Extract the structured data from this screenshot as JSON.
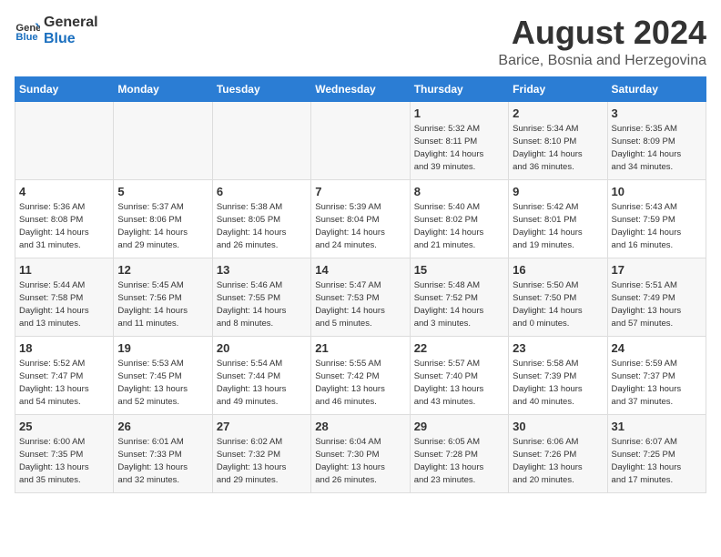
{
  "header": {
    "logo_line1": "General",
    "logo_line2": "Blue",
    "month_year": "August 2024",
    "location": "Barice, Bosnia and Herzegovina"
  },
  "days_of_week": [
    "Sunday",
    "Monday",
    "Tuesday",
    "Wednesday",
    "Thursday",
    "Friday",
    "Saturday"
  ],
  "weeks": [
    [
      {
        "day": "",
        "info": ""
      },
      {
        "day": "",
        "info": ""
      },
      {
        "day": "",
        "info": ""
      },
      {
        "day": "",
        "info": ""
      },
      {
        "day": "1",
        "info": "Sunrise: 5:32 AM\nSunset: 8:11 PM\nDaylight: 14 hours\nand 39 minutes."
      },
      {
        "day": "2",
        "info": "Sunrise: 5:34 AM\nSunset: 8:10 PM\nDaylight: 14 hours\nand 36 minutes."
      },
      {
        "day": "3",
        "info": "Sunrise: 5:35 AM\nSunset: 8:09 PM\nDaylight: 14 hours\nand 34 minutes."
      }
    ],
    [
      {
        "day": "4",
        "info": "Sunrise: 5:36 AM\nSunset: 8:08 PM\nDaylight: 14 hours\nand 31 minutes."
      },
      {
        "day": "5",
        "info": "Sunrise: 5:37 AM\nSunset: 8:06 PM\nDaylight: 14 hours\nand 29 minutes."
      },
      {
        "day": "6",
        "info": "Sunrise: 5:38 AM\nSunset: 8:05 PM\nDaylight: 14 hours\nand 26 minutes."
      },
      {
        "day": "7",
        "info": "Sunrise: 5:39 AM\nSunset: 8:04 PM\nDaylight: 14 hours\nand 24 minutes."
      },
      {
        "day": "8",
        "info": "Sunrise: 5:40 AM\nSunset: 8:02 PM\nDaylight: 14 hours\nand 21 minutes."
      },
      {
        "day": "9",
        "info": "Sunrise: 5:42 AM\nSunset: 8:01 PM\nDaylight: 14 hours\nand 19 minutes."
      },
      {
        "day": "10",
        "info": "Sunrise: 5:43 AM\nSunset: 7:59 PM\nDaylight: 14 hours\nand 16 minutes."
      }
    ],
    [
      {
        "day": "11",
        "info": "Sunrise: 5:44 AM\nSunset: 7:58 PM\nDaylight: 14 hours\nand 13 minutes."
      },
      {
        "day": "12",
        "info": "Sunrise: 5:45 AM\nSunset: 7:56 PM\nDaylight: 14 hours\nand 11 minutes."
      },
      {
        "day": "13",
        "info": "Sunrise: 5:46 AM\nSunset: 7:55 PM\nDaylight: 14 hours\nand 8 minutes."
      },
      {
        "day": "14",
        "info": "Sunrise: 5:47 AM\nSunset: 7:53 PM\nDaylight: 14 hours\nand 5 minutes."
      },
      {
        "day": "15",
        "info": "Sunrise: 5:48 AM\nSunset: 7:52 PM\nDaylight: 14 hours\nand 3 minutes."
      },
      {
        "day": "16",
        "info": "Sunrise: 5:50 AM\nSunset: 7:50 PM\nDaylight: 14 hours\nand 0 minutes."
      },
      {
        "day": "17",
        "info": "Sunrise: 5:51 AM\nSunset: 7:49 PM\nDaylight: 13 hours\nand 57 minutes."
      }
    ],
    [
      {
        "day": "18",
        "info": "Sunrise: 5:52 AM\nSunset: 7:47 PM\nDaylight: 13 hours\nand 54 minutes."
      },
      {
        "day": "19",
        "info": "Sunrise: 5:53 AM\nSunset: 7:45 PM\nDaylight: 13 hours\nand 52 minutes."
      },
      {
        "day": "20",
        "info": "Sunrise: 5:54 AM\nSunset: 7:44 PM\nDaylight: 13 hours\nand 49 minutes."
      },
      {
        "day": "21",
        "info": "Sunrise: 5:55 AM\nSunset: 7:42 PM\nDaylight: 13 hours\nand 46 minutes."
      },
      {
        "day": "22",
        "info": "Sunrise: 5:57 AM\nSunset: 7:40 PM\nDaylight: 13 hours\nand 43 minutes."
      },
      {
        "day": "23",
        "info": "Sunrise: 5:58 AM\nSunset: 7:39 PM\nDaylight: 13 hours\nand 40 minutes."
      },
      {
        "day": "24",
        "info": "Sunrise: 5:59 AM\nSunset: 7:37 PM\nDaylight: 13 hours\nand 37 minutes."
      }
    ],
    [
      {
        "day": "25",
        "info": "Sunrise: 6:00 AM\nSunset: 7:35 PM\nDaylight: 13 hours\nand 35 minutes."
      },
      {
        "day": "26",
        "info": "Sunrise: 6:01 AM\nSunset: 7:33 PM\nDaylight: 13 hours\nand 32 minutes."
      },
      {
        "day": "27",
        "info": "Sunrise: 6:02 AM\nSunset: 7:32 PM\nDaylight: 13 hours\nand 29 minutes."
      },
      {
        "day": "28",
        "info": "Sunrise: 6:04 AM\nSunset: 7:30 PM\nDaylight: 13 hours\nand 26 minutes."
      },
      {
        "day": "29",
        "info": "Sunrise: 6:05 AM\nSunset: 7:28 PM\nDaylight: 13 hours\nand 23 minutes."
      },
      {
        "day": "30",
        "info": "Sunrise: 6:06 AM\nSunset: 7:26 PM\nDaylight: 13 hours\nand 20 minutes."
      },
      {
        "day": "31",
        "info": "Sunrise: 6:07 AM\nSunset: 7:25 PM\nDaylight: 13 hours\nand 17 minutes."
      }
    ]
  ]
}
